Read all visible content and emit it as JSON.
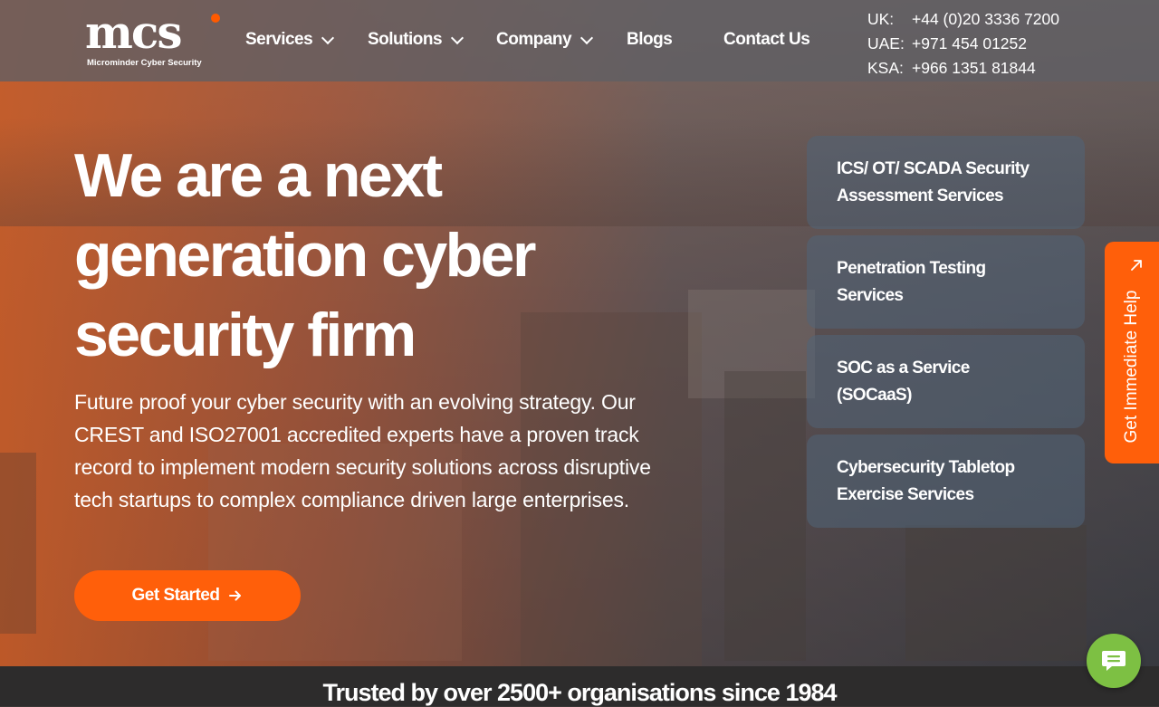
{
  "logo": {
    "word": "mcs",
    "tagline": "Microminder Cyber Security"
  },
  "nav": {
    "items": [
      {
        "label": "Services",
        "has_dropdown": true
      },
      {
        "label": "Solutions",
        "has_dropdown": true
      },
      {
        "label": "Company",
        "has_dropdown": true
      },
      {
        "label": "Blogs",
        "has_dropdown": false
      },
      {
        "label": "Contact Us",
        "has_dropdown": false
      }
    ]
  },
  "contacts": [
    {
      "region": "UK:",
      "phone": "+44 (0)20 3336 7200"
    },
    {
      "region": "UAE:",
      "phone": "+971 454 01252"
    },
    {
      "region": "KSA:",
      "phone": "+966 1351 81844"
    }
  ],
  "hero": {
    "headline_lines": [
      "We are a next",
      "generation cyber",
      "security firm"
    ],
    "subtext": "Future proof your cyber security with an evolving strategy. Our CREST and ISO27001 accredited experts have a proven track record to implement modern security solutions across disruptive tech startups to complex compliance driven large enterprises.",
    "cta_label": "Get Started"
  },
  "service_cards": [
    {
      "line1": "ICS/ OT/ SCADA Security",
      "line2": "Assessment Services"
    },
    {
      "line1": "Penetration Testing",
      "line2": "Services"
    },
    {
      "line1": "SOC as a Service",
      "line2": "(SOCaaS)"
    },
    {
      "line1": "Cybersecurity Tabletop",
      "line2": "Exercise Services"
    }
  ],
  "help_tab": {
    "label": "Get Immediate Help"
  },
  "trusted": {
    "text": "Trusted by over 2500+ organisations since 1984"
  },
  "colors": {
    "accent": "#ff5f0a",
    "chat": "#7dc043",
    "header_bg": "#5f5f64"
  },
  "icons": {
    "dropdown": "chevron-down-icon",
    "cta": "arrow-right-icon",
    "help": "arrow-up-right-icon",
    "chat": "chat-bubble-icon"
  }
}
